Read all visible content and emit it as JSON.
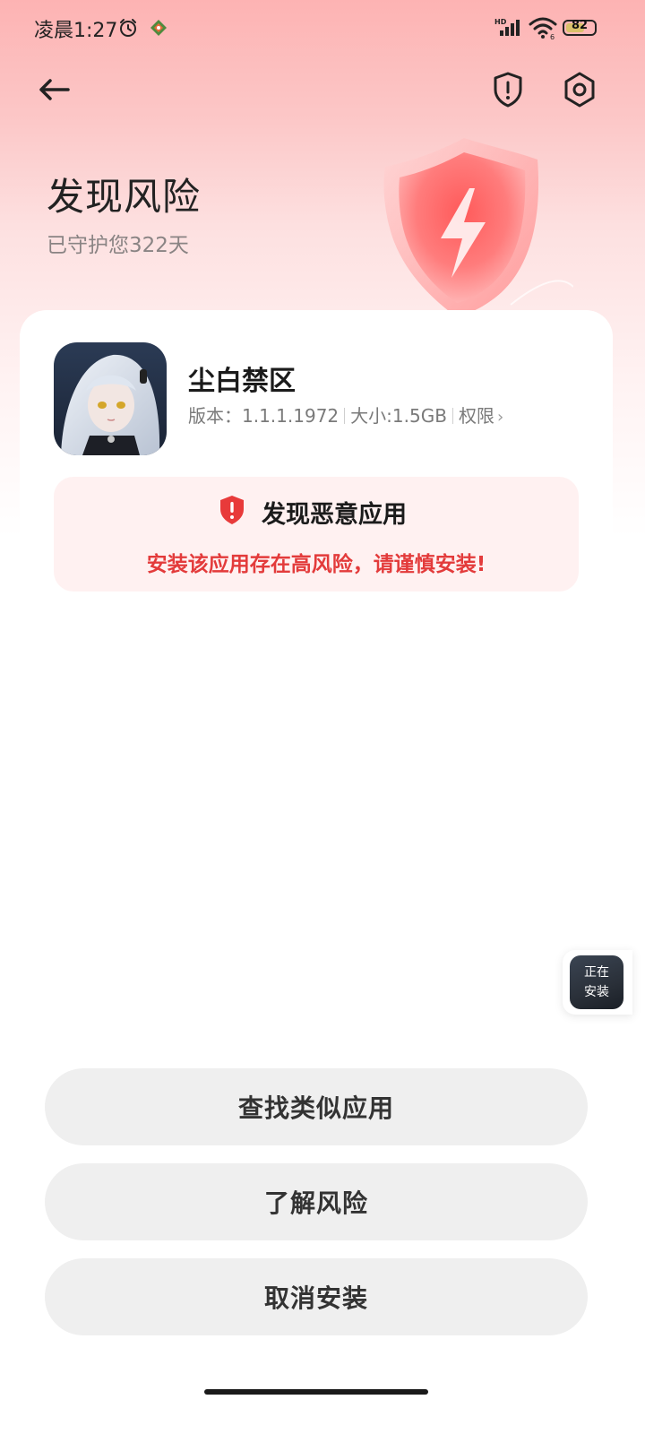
{
  "status_bar": {
    "time": "凌晨1:27",
    "battery": "82",
    "signal_label": "HD",
    "wifi_label": "6"
  },
  "header": {
    "title": "发现风险",
    "subtitle": "已守护您322天"
  },
  "app": {
    "name": "尘白禁区",
    "version_label": "版本：",
    "version": "1.1.1.1972",
    "size_label": "大小:",
    "size": "1.5GB",
    "permissions": "权限"
  },
  "warning": {
    "title": "发现恶意应用",
    "message": "安装该应用存在高风险，请谨慎安装!"
  },
  "floating_status": {
    "line1": "正在",
    "line2": "安装"
  },
  "actions": {
    "find_similar": "查找类似应用",
    "learn_risk": "了解风险",
    "cancel_install": "取消安装"
  },
  "colors": {
    "accent_red": "#e33b3b",
    "hero_pink": "#fdb3b3",
    "button_bg": "#efefef"
  }
}
